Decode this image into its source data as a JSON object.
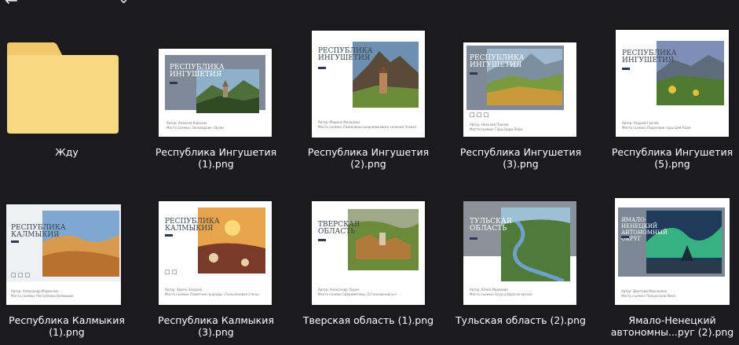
{
  "items": [
    {
      "name": "Жду",
      "type": "folder"
    },
    {
      "name": "Республика Ингушетия (1).png",
      "type": "image",
      "card": {
        "title": "РЕСПУБЛИКА ИНГУШЕТИЯ",
        "caption_author": "Автор: Алексей Корнеев",
        "caption_place": "Место съемки: Заповедник «Эрзи»"
      }
    },
    {
      "name": "Республика Ингушетия (2).png",
      "type": "image",
      "card": {
        "title": "РЕСПУБЛИКА ИНГУШЕТИЯ",
        "caption_author": "Автор: Марина Малахова",
        "caption_place": "Место съемки: Развалины средневекового селения Эгикал"
      }
    },
    {
      "name": "Республика Ингушетия (3).png",
      "type": "image",
      "card": {
        "title": "РЕСПУБЛИКА ИНГУШЕТИЯ",
        "caption_author": "Автор: Николай Павлов",
        "caption_place": "Место съемки: Горы Цори-Лоам"
      }
    },
    {
      "name": "Республика Ингушетия (5).png",
      "type": "image",
      "card": {
        "title": "РЕСПУБЛИКА ИНГУШЕТИЯ",
        "caption_author": "Автор: Андрей Грачёв",
        "caption_place": "Место съемки: Подножие горы Цей-Лоам"
      }
    },
    {
      "name": "Республика Калмыкия (1).png",
      "type": "image",
      "card": {
        "title": "РЕСПУБЛИКА КАЛМЫКИЯ",
        "caption_author": "Автор: Александр Маркелов",
        "caption_place": "Место съемки: Республика Калмыкия"
      }
    },
    {
      "name": "Республика Калмыкия (3).png",
      "type": "image",
      "card": {
        "title": "РЕСПУБЛИКА КАЛМЫКИЯ",
        "caption_author": "Автор: Армен Захаров",
        "caption_place": "Место съемки: Памятник природы «Тюльпановая степь»"
      }
    },
    {
      "name": "Тверская область (1).png",
      "type": "image",
      "card": {
        "title": "ТВЕРСКАЯ ОБЛАСТЬ",
        "caption_author": "Автор: Александр Лукин",
        "caption_place": "Место съемки: Шереметевы, Останковский р-н"
      }
    },
    {
      "name": "Тульская область (2).png",
      "type": "image",
      "card": {
        "title": "ТУЛЬСКАЯ ОБЛАСТЬ",
        "caption_author": "Автор: Юлия Абрамова",
        "caption_place": "Место съемки: Блуд д.Красногорское"
      }
    },
    {
      "name": "Ямало-Ненецкий автономны...руг (2).png",
      "type": "image",
      "card": {
        "title": "ЯМАЛО-НЕНЕЦКИЙ АВТОНОМНЫЙ ОКРУГ",
        "caption_author": "Автор: Дмитрий Моисеенко",
        "caption_place": "Место съемки: Полуостров Ямал"
      }
    }
  ],
  "colors": {
    "background": "#1b1b1d",
    "folder": "#f9d883",
    "folder_tab": "#f2c86a",
    "label": "#ffffff",
    "card_panel": "#7f8a99"
  }
}
